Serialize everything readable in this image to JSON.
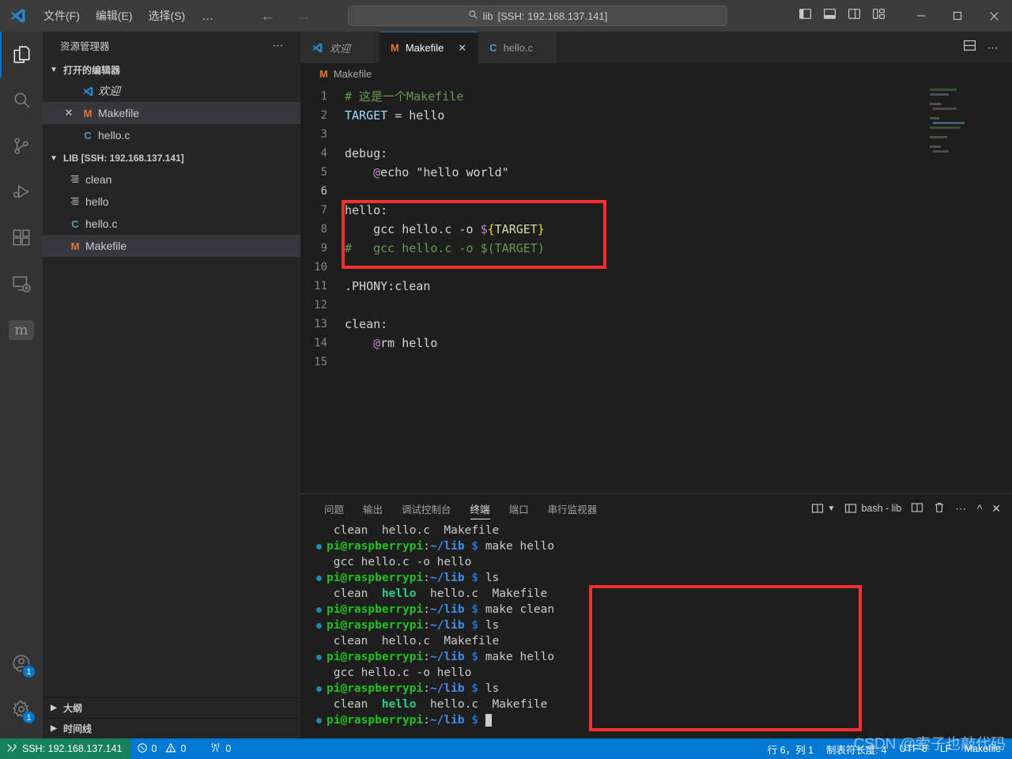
{
  "titlebar": {
    "logo_icon": "vscode-logo-icon",
    "menus": [
      "文件(F)",
      "编辑(E)",
      "选择(S)"
    ],
    "more_label": "…",
    "back_icon": "arrow-left-icon",
    "forward_icon": "arrow-right-icon",
    "quick_input": {
      "search_icon": "search-icon",
      "project": "lib",
      "remote": "[SSH: 192.168.137.141]"
    },
    "layout_icons": [
      "toggle-primary-sidebar-icon",
      "toggle-panel-icon",
      "toggle-secondary-sidebar-icon",
      "customize-layout-icon"
    ],
    "window_controls": [
      "minimize-icon",
      "maximize-icon",
      "close-icon"
    ]
  },
  "activitybar": {
    "items": [
      {
        "name": "explorer",
        "icon": "files-icon",
        "active": true
      },
      {
        "name": "search",
        "icon": "search-icon",
        "active": false
      },
      {
        "name": "source-control",
        "icon": "source-control-icon",
        "active": false
      },
      {
        "name": "run-debug",
        "icon": "run-debug-icon",
        "active": false
      },
      {
        "name": "extensions",
        "icon": "extensions-icon",
        "active": false
      },
      {
        "name": "remote-explorer",
        "icon": "remote-explorer-icon",
        "active": false
      },
      {
        "name": "platformio",
        "icon": "platformio-icon",
        "active": false
      }
    ],
    "bottom": [
      {
        "name": "accounts",
        "icon": "account-icon",
        "badge": "1"
      },
      {
        "name": "manage",
        "icon": "gear-icon",
        "badge": "1"
      }
    ]
  },
  "sidebar": {
    "title": "资源管理器",
    "more_icon": "more-actions-icon",
    "open_editors": {
      "label": "打开的编辑器",
      "items": [
        {
          "icon": "vscode-logo-icon",
          "label": "欢迎",
          "italic": true,
          "close": false,
          "selected": false
        },
        {
          "icon": "M",
          "label": "Makefile",
          "italic": false,
          "close": true,
          "selected": true
        },
        {
          "icon": "C",
          "label": "hello.c",
          "italic": false,
          "close": false,
          "selected": false
        }
      ]
    },
    "workspace": {
      "label": "LIB [SSH: 192.168.137.141]",
      "files": [
        {
          "icon": "binary",
          "label": "clean",
          "selected": false
        },
        {
          "icon": "binary",
          "label": "hello",
          "selected": false
        },
        {
          "icon": "C",
          "label": "hello.c",
          "selected": false
        },
        {
          "icon": "M",
          "label": "Makefile",
          "selected": true
        }
      ]
    },
    "collapsed_sections": [
      "大纲",
      "时间线"
    ]
  },
  "tabs": [
    {
      "icon": "vscode-logo-icon",
      "label": "欢迎",
      "active": false,
      "closable": false,
      "italic": true
    },
    {
      "icon": "M",
      "label": "Makefile",
      "active": true,
      "closable": true,
      "italic": false
    },
    {
      "icon": "C",
      "label": "hello.c",
      "active": false,
      "closable": false,
      "italic": false
    }
  ],
  "editor_actions": [
    "split-editor-down-icon",
    "more-actions-icon"
  ],
  "breadcrumb": {
    "icon": "M",
    "label": "Makefile"
  },
  "code": {
    "filename": "Makefile",
    "lines": [
      {
        "n": "1",
        "tokens": [
          {
            "t": "# 这是一个Makefile",
            "c": "t-comment"
          }
        ]
      },
      {
        "n": "2",
        "tokens": [
          {
            "t": "TARGET",
            "c": "t-var"
          },
          {
            "t": " = ",
            "c": "t-op"
          },
          {
            "t": "hello",
            "c": "t-plain"
          }
        ]
      },
      {
        "n": "3",
        "tokens": []
      },
      {
        "n": "4",
        "tokens": [
          {
            "t": "debug",
            "c": "t-plain"
          },
          {
            "t": ":",
            "c": "t-op"
          }
        ]
      },
      {
        "n": "5",
        "tokens": [
          {
            "t": "    ",
            "c": "t-plain"
          },
          {
            "t": "@",
            "c": "t-at"
          },
          {
            "t": "echo ",
            "c": "t-plain"
          },
          {
            "t": "\"hello world\"",
            "c": "t-plain"
          }
        ]
      },
      {
        "n": "6",
        "tokens": [],
        "current": true
      },
      {
        "n": "7",
        "tokens": [
          {
            "t": "hello",
            "c": "t-plain"
          },
          {
            "t": ":",
            "c": "t-op"
          }
        ]
      },
      {
        "n": "8",
        "tokens": [
          {
            "t": "    gcc hello.c -o ",
            "c": "t-plain"
          },
          {
            "t": "$",
            "c": "t-at"
          },
          {
            "t": "{",
            "c": "t-brace"
          },
          {
            "t": "TARGET",
            "c": "t-target"
          },
          {
            "t": "}",
            "c": "t-brace"
          }
        ]
      },
      {
        "n": "9",
        "tokens": [
          {
            "t": "#   gcc hello.c -o $(TARGET)",
            "c": "t-comment"
          }
        ]
      },
      {
        "n": "10",
        "tokens": []
      },
      {
        "n": "11",
        "tokens": [
          {
            "t": ".PHONY",
            "c": "t-plain"
          },
          {
            "t": ":",
            "c": "t-op"
          },
          {
            "t": "clean",
            "c": "t-plain"
          }
        ]
      },
      {
        "n": "12",
        "tokens": []
      },
      {
        "n": "13",
        "tokens": [
          {
            "t": "clean",
            "c": "t-plain"
          },
          {
            "t": ":",
            "c": "t-op"
          }
        ]
      },
      {
        "n": "14",
        "tokens": [
          {
            "t": "    ",
            "c": "t-plain"
          },
          {
            "t": "@",
            "c": "t-at"
          },
          {
            "t": "rm hello",
            "c": "t-plain"
          }
        ]
      },
      {
        "n": "15",
        "tokens": []
      }
    ],
    "highlight_note": "red annotation box around lines 7-9"
  },
  "panel": {
    "tabs": [
      "问题",
      "输出",
      "调试控制台",
      "终端",
      "端口",
      "串行监视器"
    ],
    "active_tab": "终端",
    "actions": {
      "split_dropdown_icon": "split-terminal-dropdown-icon",
      "terminal_name": "bash - lib",
      "split_icon": "split-terminal-icon",
      "kill_icon": "trash-icon",
      "more_icon": "more-actions-icon",
      "maximize_icon": "chevron-up-icon",
      "close_icon": "close-icon"
    }
  },
  "terminal": {
    "lines": [
      {
        "dot": false,
        "segs": [
          {
            "t": " clean  hello.c  Makefile",
            "c": "t-cmd"
          }
        ]
      },
      {
        "dot": true,
        "segs": [
          {
            "t": "pi@raspberrypi",
            "c": "t-user"
          },
          {
            "t": ":",
            "c": "t-colon"
          },
          {
            "t": "~/lib",
            "c": "t-path"
          },
          {
            "t": " $ ",
            "c": "t-dollar"
          },
          {
            "t": "make hello",
            "c": "t-cmd"
          }
        ]
      },
      {
        "dot": false,
        "segs": [
          {
            "t": " gcc hello.c -o hello",
            "c": "t-cmd"
          }
        ]
      },
      {
        "dot": true,
        "segs": [
          {
            "t": "pi@raspberrypi",
            "c": "t-user"
          },
          {
            "t": ":",
            "c": "t-colon"
          },
          {
            "t": "~/lib",
            "c": "t-path"
          },
          {
            "t": " $ ",
            "c": "t-dollar"
          },
          {
            "t": "ls",
            "c": "t-cmd"
          }
        ]
      },
      {
        "dot": false,
        "segs": [
          {
            "t": " clean  ",
            "c": "t-cmd"
          },
          {
            "t": "hello",
            "c": "t-exec"
          },
          {
            "t": "  hello.c  Makefile",
            "c": "t-cmd"
          }
        ]
      },
      {
        "dot": true,
        "segs": [
          {
            "t": "pi@raspberrypi",
            "c": "t-user"
          },
          {
            "t": ":",
            "c": "t-colon"
          },
          {
            "t": "~/lib",
            "c": "t-path"
          },
          {
            "t": " $ ",
            "c": "t-dollar"
          },
          {
            "t": "make clean",
            "c": "t-cmd"
          }
        ]
      },
      {
        "dot": true,
        "segs": [
          {
            "t": "pi@raspberrypi",
            "c": "t-user"
          },
          {
            "t": ":",
            "c": "t-colon"
          },
          {
            "t": "~/lib",
            "c": "t-path"
          },
          {
            "t": " $ ",
            "c": "t-dollar"
          },
          {
            "t": "ls",
            "c": "t-cmd"
          }
        ]
      },
      {
        "dot": false,
        "segs": [
          {
            "t": " clean  hello.c  Makefile",
            "c": "t-cmd"
          }
        ]
      },
      {
        "dot": true,
        "segs": [
          {
            "t": "pi@raspberrypi",
            "c": "t-user"
          },
          {
            "t": ":",
            "c": "t-colon"
          },
          {
            "t": "~/lib",
            "c": "t-path"
          },
          {
            "t": " $ ",
            "c": "t-dollar"
          },
          {
            "t": "make hello",
            "c": "t-cmd"
          }
        ]
      },
      {
        "dot": false,
        "segs": [
          {
            "t": " gcc hello.c -o hello",
            "c": "t-cmd"
          }
        ]
      },
      {
        "dot": true,
        "segs": [
          {
            "t": "pi@raspberrypi",
            "c": "t-user"
          },
          {
            "t": ":",
            "c": "t-colon"
          },
          {
            "t": "~/lib",
            "c": "t-path"
          },
          {
            "t": " $ ",
            "c": "t-dollar"
          },
          {
            "t": "ls",
            "c": "t-cmd"
          }
        ]
      },
      {
        "dot": false,
        "segs": [
          {
            "t": " clean  ",
            "c": "t-cmd"
          },
          {
            "t": "hello",
            "c": "t-exec"
          },
          {
            "t": "  hello.c  Makefile",
            "c": "t-cmd"
          }
        ]
      },
      {
        "dot": true,
        "segs": [
          {
            "t": "pi@raspberrypi",
            "c": "t-user"
          },
          {
            "t": ":",
            "c": "t-colon"
          },
          {
            "t": "~/lib",
            "c": "t-path"
          },
          {
            "t": " $ ",
            "c": "t-dollar"
          }
        ],
        "cursor": true
      }
    ]
  },
  "statusbar": {
    "ssh_icon": "remote-ssh-icon",
    "ssh_label": "SSH: 192.168.137.141",
    "errors_icon": "error-icon",
    "errors": "0",
    "warnings_icon": "warning-icon",
    "warnings": "0",
    "ports_icon": "radio-tower-icon",
    "ports": "0",
    "cursor_position": "行 6，列 1",
    "tab_size": "制表符长度: 4",
    "encoding": "UTF-8",
    "eol": "LF",
    "language": "Makefile",
    "watermark": "CSDN @索子也敲代码"
  },
  "colors": {
    "accent": "#0078d4",
    "remote_green": "#16825d",
    "annotation_red": "#fc2f2f",
    "editor_bg": "#1e1e1e",
    "sidebar_bg": "#252526",
    "titlebar_bg": "#3c3c3c"
  }
}
